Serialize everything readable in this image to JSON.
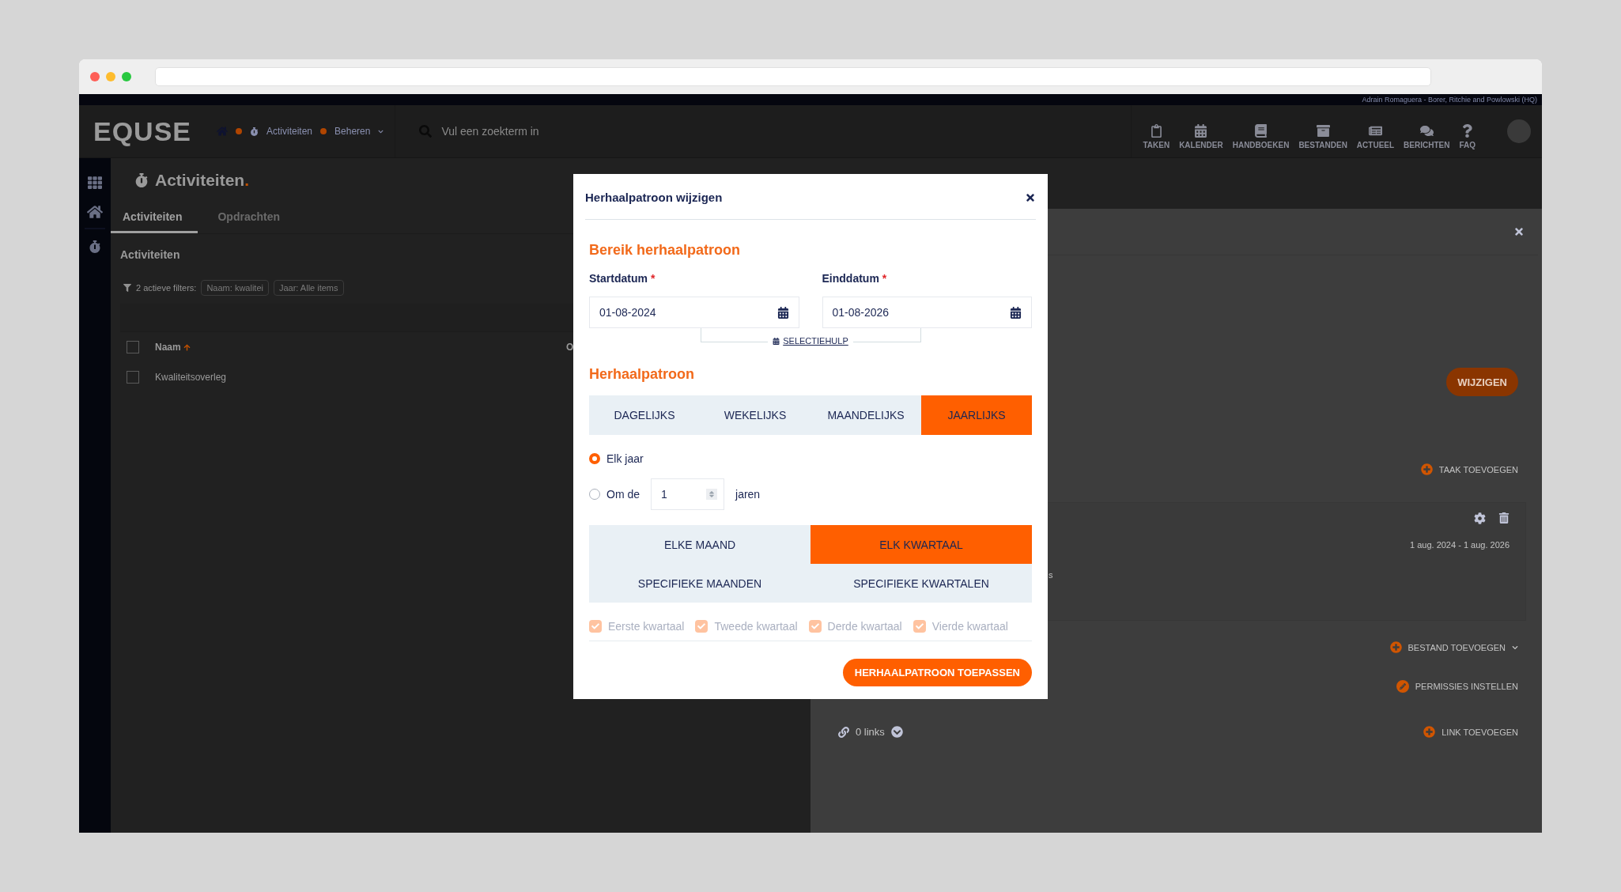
{
  "app": {
    "user_label": "Adrain Romaguera - Borer, Ritchie and Powlowski (HQ)",
    "logo": "EQUSE",
    "breadcrumbs": [
      {
        "label": "Activiteiten"
      },
      {
        "label": "Beheren"
      }
    ],
    "search": {
      "placeholder": "Vul een zoekterm in"
    },
    "nav": [
      {
        "label": "TAKEN"
      },
      {
        "label": "KALENDER"
      },
      {
        "label": "HANDBOEKEN"
      },
      {
        "label": "BESTANDEN"
      },
      {
        "label": "ACTUEEL"
      },
      {
        "label": "BERICHTEN"
      },
      {
        "label": "FAQ"
      }
    ]
  },
  "page": {
    "title": "Activiteiten",
    "title_dot": ".",
    "tabs": [
      {
        "label": "Activiteiten",
        "selected": true
      },
      {
        "label": "Opdrachten",
        "selected": false
      }
    ],
    "section_title": "Activiteiten",
    "filters": {
      "label": "2 actieve filters:",
      "chips": [
        "Naam: kwalitei",
        "Jaar: Alle items"
      ]
    },
    "table": {
      "header_checked": false,
      "columns": [
        "Naam",
        "O"
      ],
      "rows": [
        {
          "checked": false,
          "cells": [
            "Kwaliteitsoverleg"
          ]
        }
      ]
    }
  },
  "detail_panel": {
    "edit_button": "WIJZIGEN",
    "add_task": "TAAK TOEVOEGEN",
    "card": {
      "fragment": "s",
      "date_range": "1 aug. 2024 - 1 aug. 2026"
    },
    "actions": [
      {
        "kind": "add",
        "label": "BESTAND TOEVOEGEN",
        "dropdown": true
      },
      {
        "kind": "edit",
        "label": "PERMISSIES INSTELLEN",
        "dropdown": false
      }
    ],
    "links": {
      "count": "0 links",
      "add": "LINK TOEVOEGEN"
    }
  },
  "modal": {
    "title": "Herhaalpatroon wijzigen",
    "range": {
      "heading": "Bereik herhaalpatroon",
      "fields": [
        {
          "label": "Startdatum",
          "required_mark": "*",
          "value": "01-08-2024"
        },
        {
          "label": "Einddatum",
          "required_mark": "*",
          "value": "01-08-2026"
        }
      ],
      "helper": "SELECTIEHULP"
    },
    "pattern": {
      "heading": "Herhaalpatroon",
      "tabs": [
        {
          "label": "DAGELIJKS",
          "selected": false
        },
        {
          "label": "WEKELIJKS",
          "selected": false
        },
        {
          "label": "MAANDELIJKS",
          "selected": false
        },
        {
          "label": "JAARLIJKS",
          "selected": true
        }
      ],
      "options": [
        {
          "kind": "plain",
          "label": "Elk jaar",
          "selected": true
        },
        {
          "kind": "interval",
          "label": "Om de",
          "value": "1",
          "unit": "jaren",
          "selected": false
        }
      ],
      "scopes": [
        {
          "label": "ELKE MAAND",
          "selected": false
        },
        {
          "label": "ELK KWARTAAL",
          "selected": true
        },
        {
          "label": "SPECIFIEKE MAANDEN",
          "selected": false
        },
        {
          "label": "SPECIFIEKE KWARTALEN",
          "selected": false
        }
      ],
      "quarters": [
        {
          "label": "Eerste kwartaal",
          "checked": true,
          "disabled": true
        },
        {
          "label": "Tweede kwartaal",
          "checked": true,
          "disabled": true
        },
        {
          "label": "Derde kwartaal",
          "checked": true,
          "disabled": true
        },
        {
          "label": "Vierde kwartaal",
          "checked": true,
          "disabled": true
        }
      ]
    },
    "apply_button": "HERHAALPATROON TOEPASSEN"
  }
}
